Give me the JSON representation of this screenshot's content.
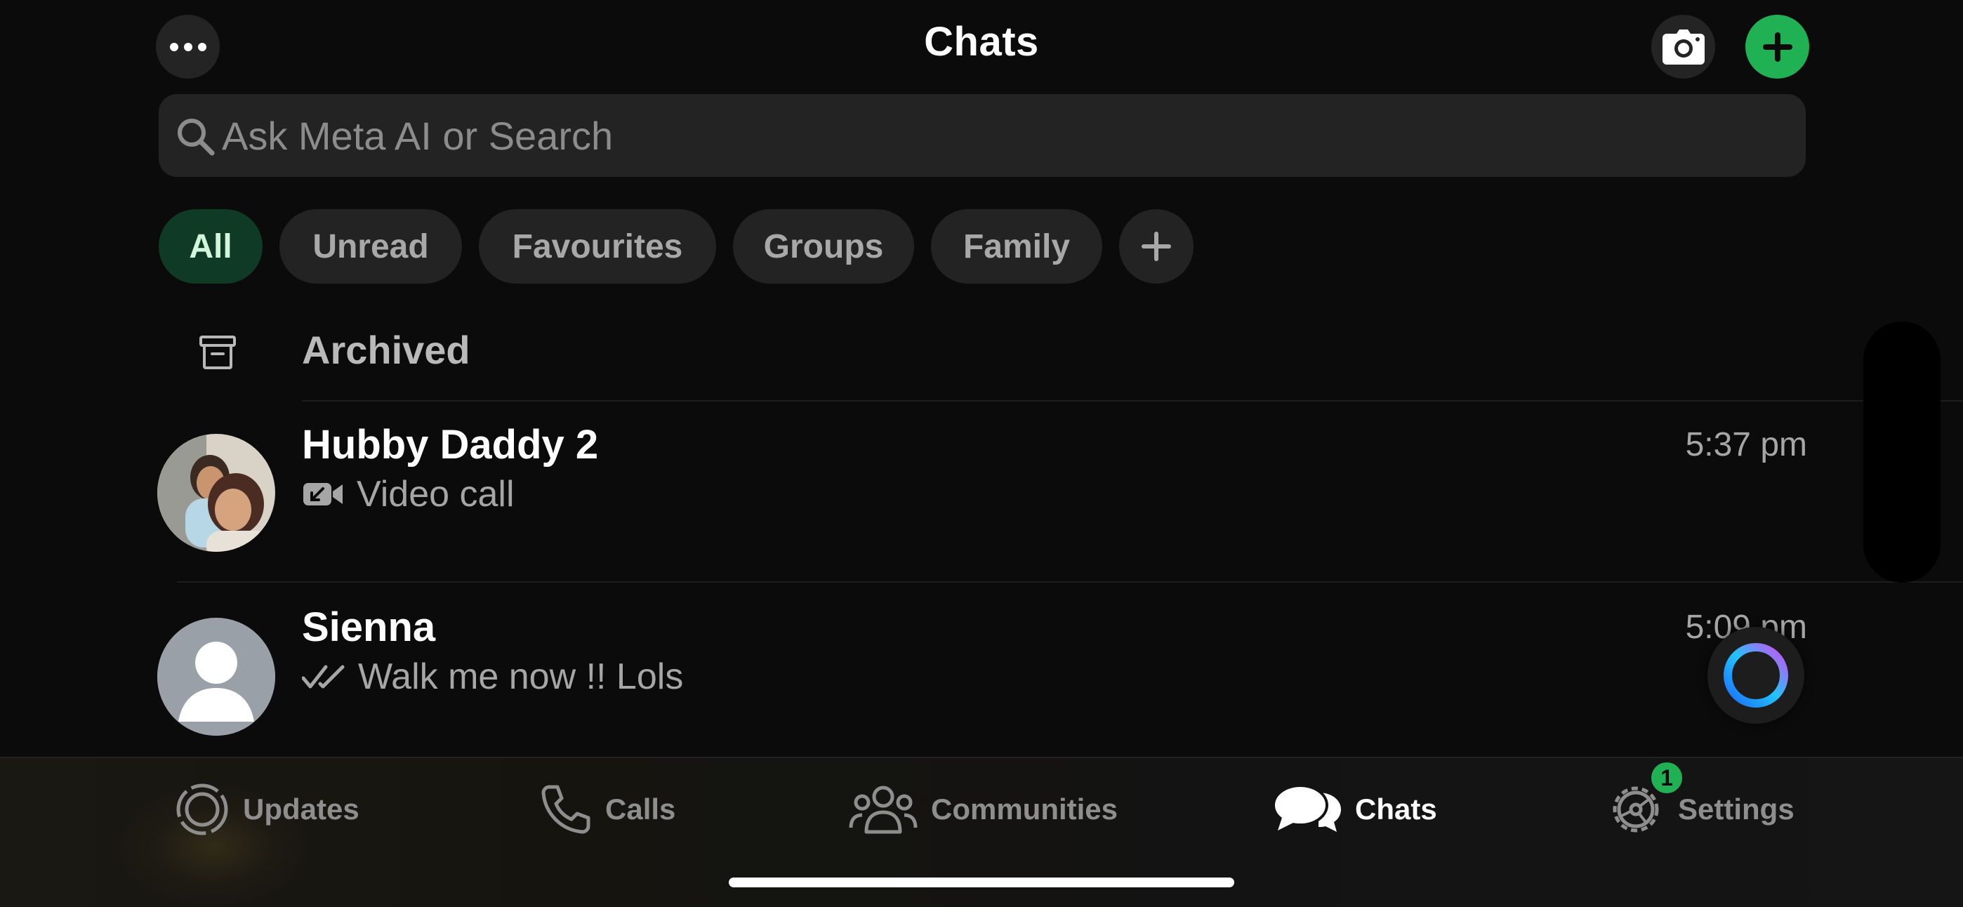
{
  "header": {
    "title": "Chats",
    "more_icon": "ellipsis-icon",
    "camera_icon": "camera-icon",
    "new_chat_icon": "plus-icon"
  },
  "search": {
    "placeholder": "Ask Meta AI or Search"
  },
  "filters": [
    {
      "label": "All",
      "active": true
    },
    {
      "label": "Unread",
      "active": false
    },
    {
      "label": "Favourites",
      "active": false
    },
    {
      "label": "Groups",
      "active": false
    },
    {
      "label": "Family",
      "active": false
    }
  ],
  "add_filter_icon": "plus-icon",
  "archived": {
    "label": "Archived",
    "icon": "archive-icon"
  },
  "chats": [
    {
      "name": "Hubby Daddy 2",
      "preview": "Video call",
      "preview_icon": "incoming-video-call-icon",
      "time": "5:37 pm"
    },
    {
      "name": "Sienna",
      "preview": "Walk me now !! Lols",
      "preview_icon": "double-check-icon",
      "time": "5:09 pm"
    }
  ],
  "tabs": [
    {
      "label": "Updates",
      "icon": "updates-icon",
      "active": false
    },
    {
      "label": "Calls",
      "icon": "phone-icon",
      "active": false
    },
    {
      "label": "Communities",
      "icon": "communities-icon",
      "active": false
    },
    {
      "label": "Chats",
      "icon": "chats-icon",
      "active": true
    },
    {
      "label": "Settings",
      "icon": "gear-icon",
      "active": false,
      "badge": "1"
    }
  ],
  "colors": {
    "accent": "#1fb154",
    "background": "#0b0b0b",
    "chip_active": "#0f3a26"
  }
}
